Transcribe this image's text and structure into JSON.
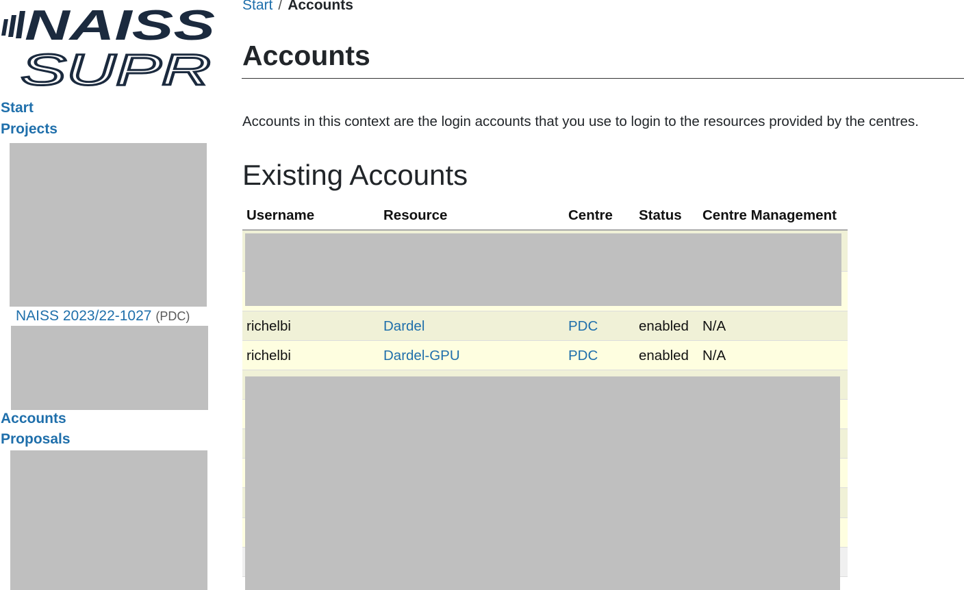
{
  "logo": {
    "line1": "NAISS",
    "line2": "SUPR",
    "color": "#1b2a3e"
  },
  "sidebar": {
    "items": [
      {
        "label": "Start"
      },
      {
        "label": "Projects"
      },
      {
        "label": "Accounts"
      },
      {
        "label": "Proposals"
      }
    ],
    "project": {
      "name": "NAISS 2023/22-1027",
      "centre": "(PDC)"
    }
  },
  "breadcrumb": {
    "items": [
      {
        "label": "Start"
      }
    ],
    "separator": "/",
    "current": "Accounts"
  },
  "page": {
    "title": "Accounts",
    "intro": "Accounts in this context are the login accounts that you use to login to the resources provided by the centres.",
    "section_title": "Existing Accounts"
  },
  "table": {
    "columns": [
      "Username",
      "Resource",
      "Centre",
      "Status",
      "Centre Management"
    ],
    "rows": [
      {
        "username": "richelbi",
        "resource": "Dardel",
        "centre": "PDC",
        "status": "enabled",
        "management": "N/A"
      },
      {
        "username": "richelbi",
        "resource": "Dardel-GPU",
        "centre": "PDC",
        "status": "enabled",
        "management": "N/A"
      }
    ]
  },
  "colors": {
    "link": "#1f6fab",
    "row_odd": "#f0f1d7",
    "row_even": "#fefee0",
    "redaction": "#bfbfbf"
  }
}
